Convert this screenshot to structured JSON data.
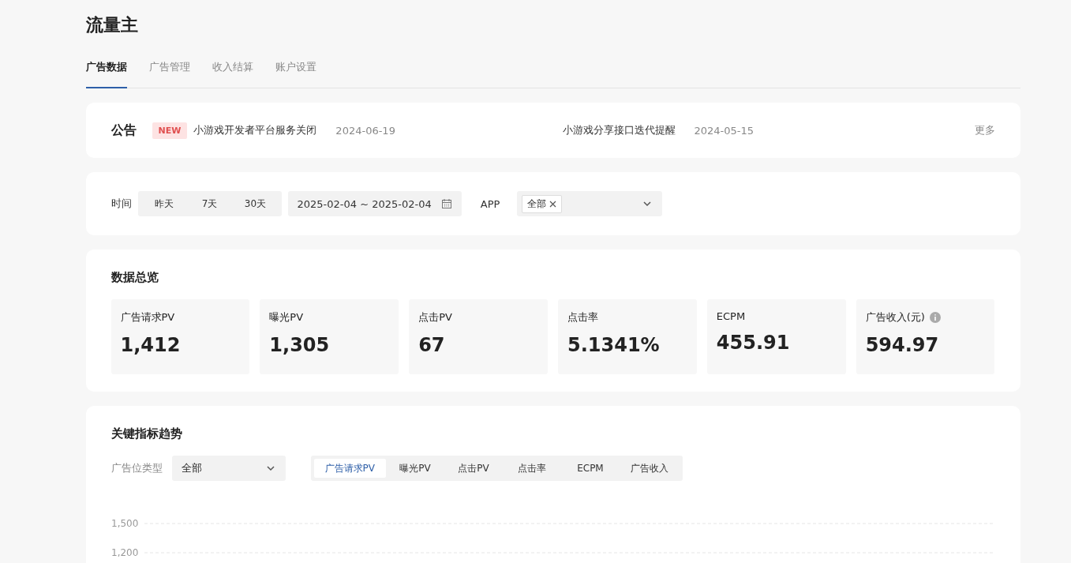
{
  "title": "流量主",
  "tabs": [
    {
      "label": "广告数据",
      "selected": true
    },
    {
      "label": "广告管理",
      "selected": false
    },
    {
      "label": "收入结算",
      "selected": false
    },
    {
      "label": "账户设置",
      "selected": false
    }
  ],
  "notice": {
    "label": "公告",
    "items": [
      {
        "badge": "NEW",
        "text": "小游戏开发者平台服务关闭",
        "date": "2024-06-19"
      },
      {
        "text": "小游戏分享接口迭代提醒",
        "date": "2024-05-15"
      }
    ],
    "more": "更多"
  },
  "filter": {
    "time_label": "时间",
    "ranges": [
      {
        "label": "昨天",
        "selected": false
      },
      {
        "label": "7天",
        "selected": false
      },
      {
        "label": "30天",
        "selected": false
      }
    ],
    "date_range": "2025-02-04 ~ 2025-02-04",
    "app_label": "APP",
    "app_tags": [
      "全部"
    ]
  },
  "overview": {
    "title": "数据总览",
    "metrics": [
      {
        "label": "广告请求PV",
        "value": "1,412"
      },
      {
        "label": "曝光PV",
        "value": "1,305"
      },
      {
        "label": "点击PV",
        "value": "67"
      },
      {
        "label": "点击率",
        "value": "5.1341%"
      },
      {
        "label": "ECPM",
        "value": "455.91"
      },
      {
        "label": "广告收入(元)",
        "value": "594.97",
        "info": true
      }
    ]
  },
  "trend": {
    "title": "关键指标趋势",
    "slot_label": "广告位类型",
    "slot_value": "全部",
    "metric_tabs": [
      {
        "label": "广告请求PV",
        "selected": true
      },
      {
        "label": "曝光PV",
        "selected": false
      },
      {
        "label": "点击PV",
        "selected": false
      },
      {
        "label": "点击率",
        "selected": false
      },
      {
        "label": "ECPM",
        "selected": false
      },
      {
        "label": "广告收入",
        "selected": false
      }
    ],
    "axis_labels": [
      "1,500",
      "1,200"
    ]
  }
}
